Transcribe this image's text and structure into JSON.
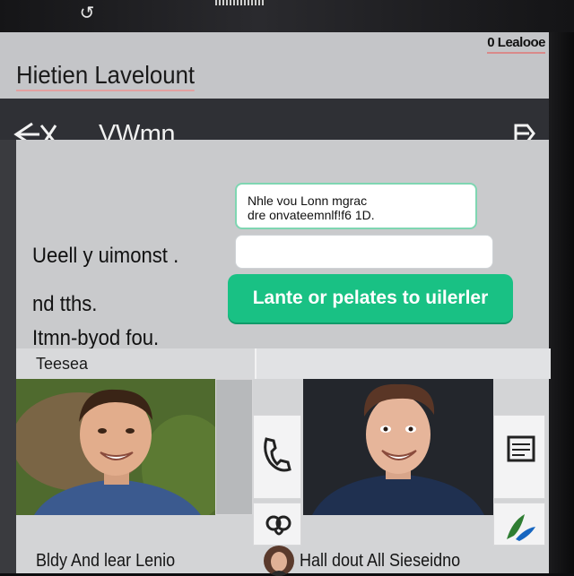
{
  "status_bar": {
    "text": "0 Lealooe"
  },
  "app": {
    "title": "Hietien Lavelount"
  },
  "nav": {
    "back_icon": "back-arrow-icon",
    "title": "VWmn",
    "menu_icon": "drawer-icon"
  },
  "main": {
    "lines": [
      "Ueell y uimonst .",
      "nd tths.",
      "Itmn-byod fou."
    ],
    "info_card": {
      "line1": "Nhle vou Lonn mgrac",
      "line2": "dre onvateemnlf!f6 1D."
    },
    "input": {
      "value": "",
      "placeholder": ""
    },
    "cta_label": "Lante or pelates to uilerler"
  },
  "section": {
    "label": "Teesea"
  },
  "gallery": {
    "items": [
      {
        "caption": "Bldy And lear Lenio"
      },
      {
        "caption": "Hall dout All Sieseidno"
      }
    ],
    "side_icons": [
      "phone-icon",
      "sticker-icon",
      "document-icon",
      "plant-icon"
    ]
  },
  "colors": {
    "nav_background": "#2f3035",
    "accent_green": "#19c184",
    "panel_gray": "#c9cacc"
  }
}
